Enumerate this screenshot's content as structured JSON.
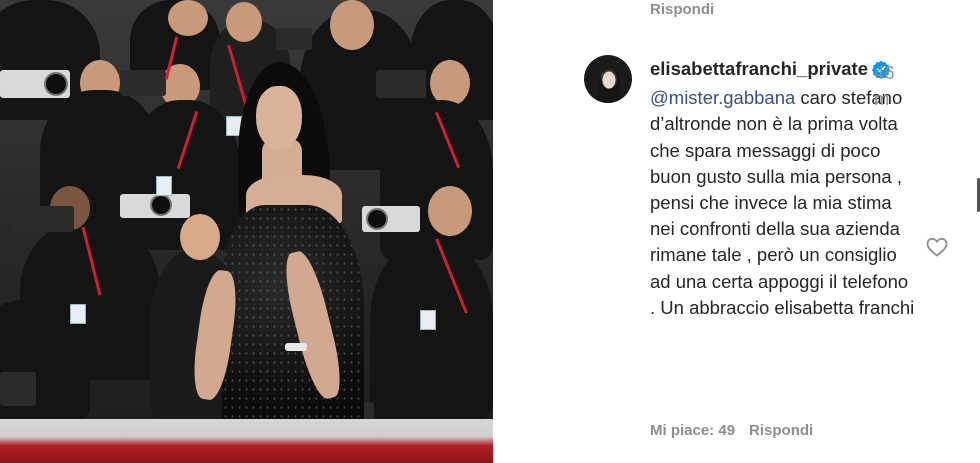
{
  "post_image": {
    "icon": "photo-red-carpet"
  },
  "previous_comment": {
    "reply_label": "Rispondi"
  },
  "comment": {
    "username": "elisabettafranchi_private",
    "verified_icon": "verified-badge-icon",
    "time": "46 m",
    "mention": "@mister.gabbana",
    "text": " caro stefano d’altronde non è la prima volta che spara messaggi di poco buon gusto sulla mia persona , pensi che invece la mia stima nei confronti della sua azienda rimane tale , però un consiglio ad una certa appoggi il telefono . Un abbraccio elisabetta franchi",
    "likes_label": "Mi piace: 49",
    "reply_label": "Rispondi",
    "like_icon": "heart-icon"
  },
  "colors": {
    "link": "#385185",
    "verified": "#0095f6",
    "muted": "#8e8e8e",
    "text": "#262626"
  }
}
